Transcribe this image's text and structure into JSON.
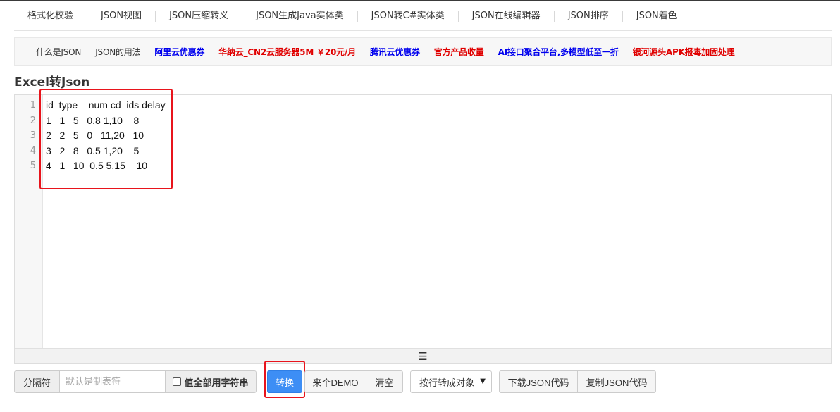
{
  "topnav": {
    "items": [
      "格式化校验",
      "JSON视图",
      "JSON压缩转义",
      "JSON生成Java实体类",
      "JSON转C#实体类",
      "JSON在线编辑器",
      "JSON排序",
      "JSON着色"
    ]
  },
  "linkbar": {
    "items": [
      {
        "label": "什么是JSON",
        "color": "#333333"
      },
      {
        "label": "JSON的用法",
        "color": "#333333"
      },
      {
        "label": "阿里云优惠券",
        "color": "#0000ee"
      },
      {
        "label": "华纳云_CN2云服务器5M ￥20元/月",
        "color": "#e00000"
      },
      {
        "label": "腾讯云优惠券",
        "color": "#0000ee"
      },
      {
        "label": "官方产品收量",
        "color": "#e00000"
      },
      {
        "label": "AI接口聚合平台,多模型低至一折",
        "color": "#0000ee"
      },
      {
        "label": "银河源头APK报毒加固处理",
        "color": "#e00000"
      }
    ]
  },
  "page": {
    "title": "Excel转Json"
  },
  "editor": {
    "line_numbers": [
      "1",
      "2",
      "3",
      "4",
      "5"
    ],
    "lines": [
      "id  type    num cd  ids delay",
      "1   1   5   0.8 1,10    8",
      "2   2   5   0   11,20   10",
      "3   2   8   0.5 1,20    5",
      "4   1   10  0.5 5,15    10"
    ],
    "resize_handle": "☰"
  },
  "toolbar": {
    "separator_label": "分隔符",
    "separator_placeholder": "默认是制表符",
    "all_string_label": "值全部用字符串",
    "convert_label": "转换",
    "demo_label": "来个DEMO",
    "clear_label": "清空",
    "mode_selected": "按行转成对象",
    "download_label": "下载JSON代码",
    "copy_label": "复制JSON代码"
  },
  "colors": {
    "highlight": "#e8141c",
    "primary_button": "#3d8ef5"
  }
}
